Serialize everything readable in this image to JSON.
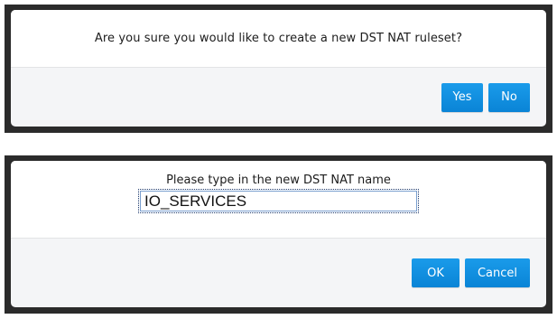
{
  "confirm_dialog": {
    "message": "Are you sure you would like to create a new DST NAT ruleset?",
    "yes_label": "Yes",
    "no_label": "No"
  },
  "prompt_dialog": {
    "label": "Please type in the new DST NAT name",
    "input_value": "IO_SERVICES",
    "ok_label": "OK",
    "cancel_label": "Cancel"
  },
  "colors": {
    "button_blue": "#0e8ee0",
    "dialog_border": "#2b2b2b",
    "footer_bg": "#f4f5f7"
  }
}
